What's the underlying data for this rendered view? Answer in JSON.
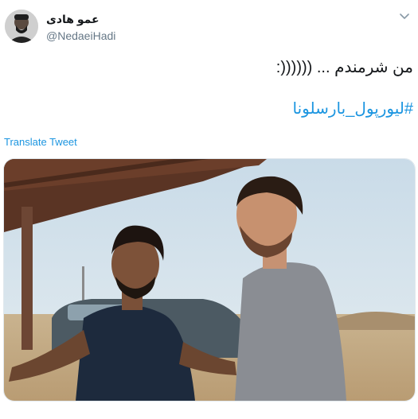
{
  "author": {
    "display_name": "عمو هادی",
    "handle": "@NedaeiHadi"
  },
  "tweet": {
    "text": "من شرمندم ... ((((((:",
    "hashtag": "#لیورپول_بارسلونا",
    "translate_label": "Translate Tweet"
  },
  "icons": {
    "menu": "chevron-down-icon"
  },
  "colors": {
    "link": "#1b95e0",
    "text": "#14171a",
    "secondary": "#657786"
  }
}
